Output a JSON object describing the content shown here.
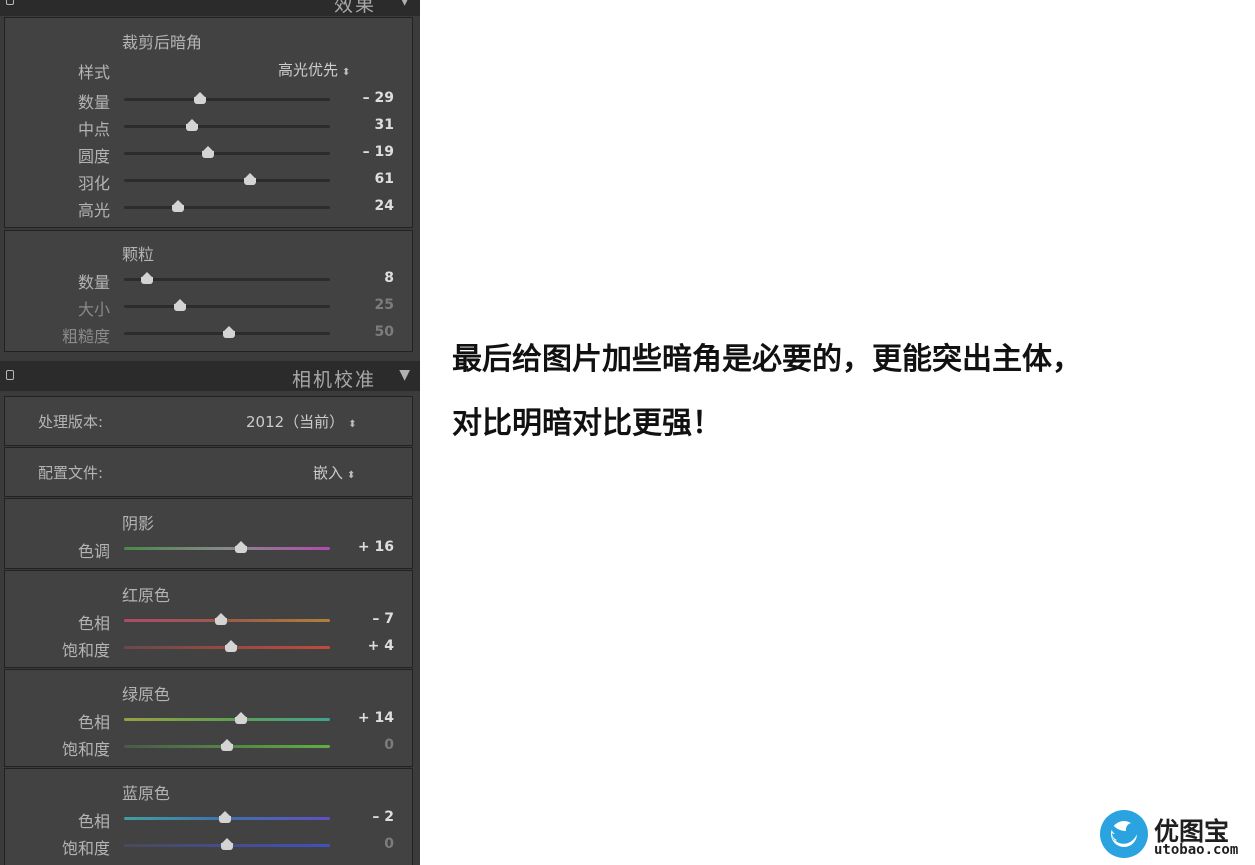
{
  "effects_section": {
    "header_title": "效果",
    "vignette": {
      "title": "裁剪后暗角",
      "style_label": "样式",
      "style_value": "高光优先",
      "sliders": [
        {
          "label": "数量",
          "value": "– 29",
          "position": 0.37
        },
        {
          "label": "中点",
          "value": "31",
          "position": 0.33
        },
        {
          "label": "圆度",
          "value": "– 19",
          "position": 0.41
        },
        {
          "label": "羽化",
          "value": "61",
          "position": 0.61
        },
        {
          "label": "高光",
          "value": "24",
          "position": 0.26
        }
      ]
    },
    "grain": {
      "title": "颗粒",
      "sliders": [
        {
          "label": "数量",
          "value": "8",
          "position": 0.11
        },
        {
          "label": "大小",
          "value": "25",
          "position": 0.27
        },
        {
          "label": "粗糙度",
          "value": "50",
          "position": 0.51
        }
      ]
    }
  },
  "calibration_section": {
    "header_title": "相机校准",
    "process_label": "处理版本:",
    "process_value": "2012（当前）",
    "profile_label": "配置文件:",
    "profile_value": "嵌入",
    "shadows": {
      "title": "阴影",
      "sliders": [
        {
          "label": "色调",
          "value": "+ 16",
          "position": 0.57
        }
      ]
    },
    "red_primary": {
      "title": "红原色",
      "sliders": [
        {
          "label": "色相",
          "value": "– 7",
          "position": 0.47
        },
        {
          "label": "饱和度",
          "value": "+ 4",
          "position": 0.52
        }
      ]
    },
    "green_primary": {
      "title": "绿原色",
      "sliders": [
        {
          "label": "色相",
          "value": "+ 14",
          "position": 0.57
        },
        {
          "label": "饱和度",
          "value": "0",
          "position": 0.5
        }
      ]
    },
    "blue_primary": {
      "title": "蓝原色",
      "sliders": [
        {
          "label": "色相",
          "value": "– 2",
          "position": 0.49
        },
        {
          "label": "饱和度",
          "value": "0",
          "position": 0.5
        }
      ]
    }
  },
  "caption": {
    "line1": "最后给图片加些暗角是必要的，更能突出主体，",
    "line2": "对比明暗对比更强！"
  },
  "watermark": {
    "brand": "优图宝",
    "url": "utobao.com",
    "brand_color": "#2aa3e0"
  },
  "colors": {
    "panel_bg": "#3b3b3b",
    "header_bg": "#2b2b2b",
    "track_dark": "#2c2c2c"
  }
}
